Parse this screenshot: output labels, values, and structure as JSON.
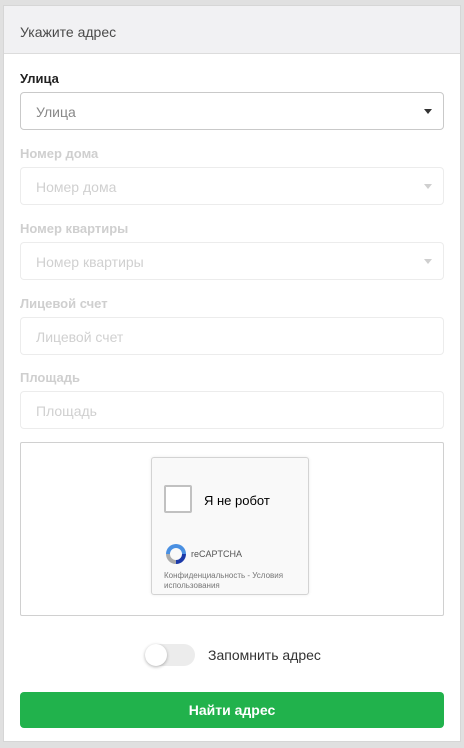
{
  "header": {
    "title": "Укажите адрес"
  },
  "fields": {
    "street": {
      "label": "Улица",
      "placeholder": "Улица"
    },
    "house": {
      "label": "Номер дома",
      "placeholder": "Номер дома"
    },
    "apartment": {
      "label": "Номер квартиры",
      "placeholder": "Номер квартиры"
    },
    "account": {
      "label": "Лицевой счет",
      "placeholder": "Лицевой счет"
    },
    "area": {
      "label": "Площадь",
      "placeholder": "Площадь"
    }
  },
  "captcha": {
    "checkbox_label": "Я не робот",
    "brand": "reCAPTCHA",
    "links": "Конфиденциальность - Условия использования"
  },
  "remember": {
    "label": "Запомнить адрес",
    "enabled": false
  },
  "submit": {
    "label": "Найти адрес"
  },
  "colors": {
    "accent": "#21b24c",
    "header_bg": "#f1f1f3"
  }
}
